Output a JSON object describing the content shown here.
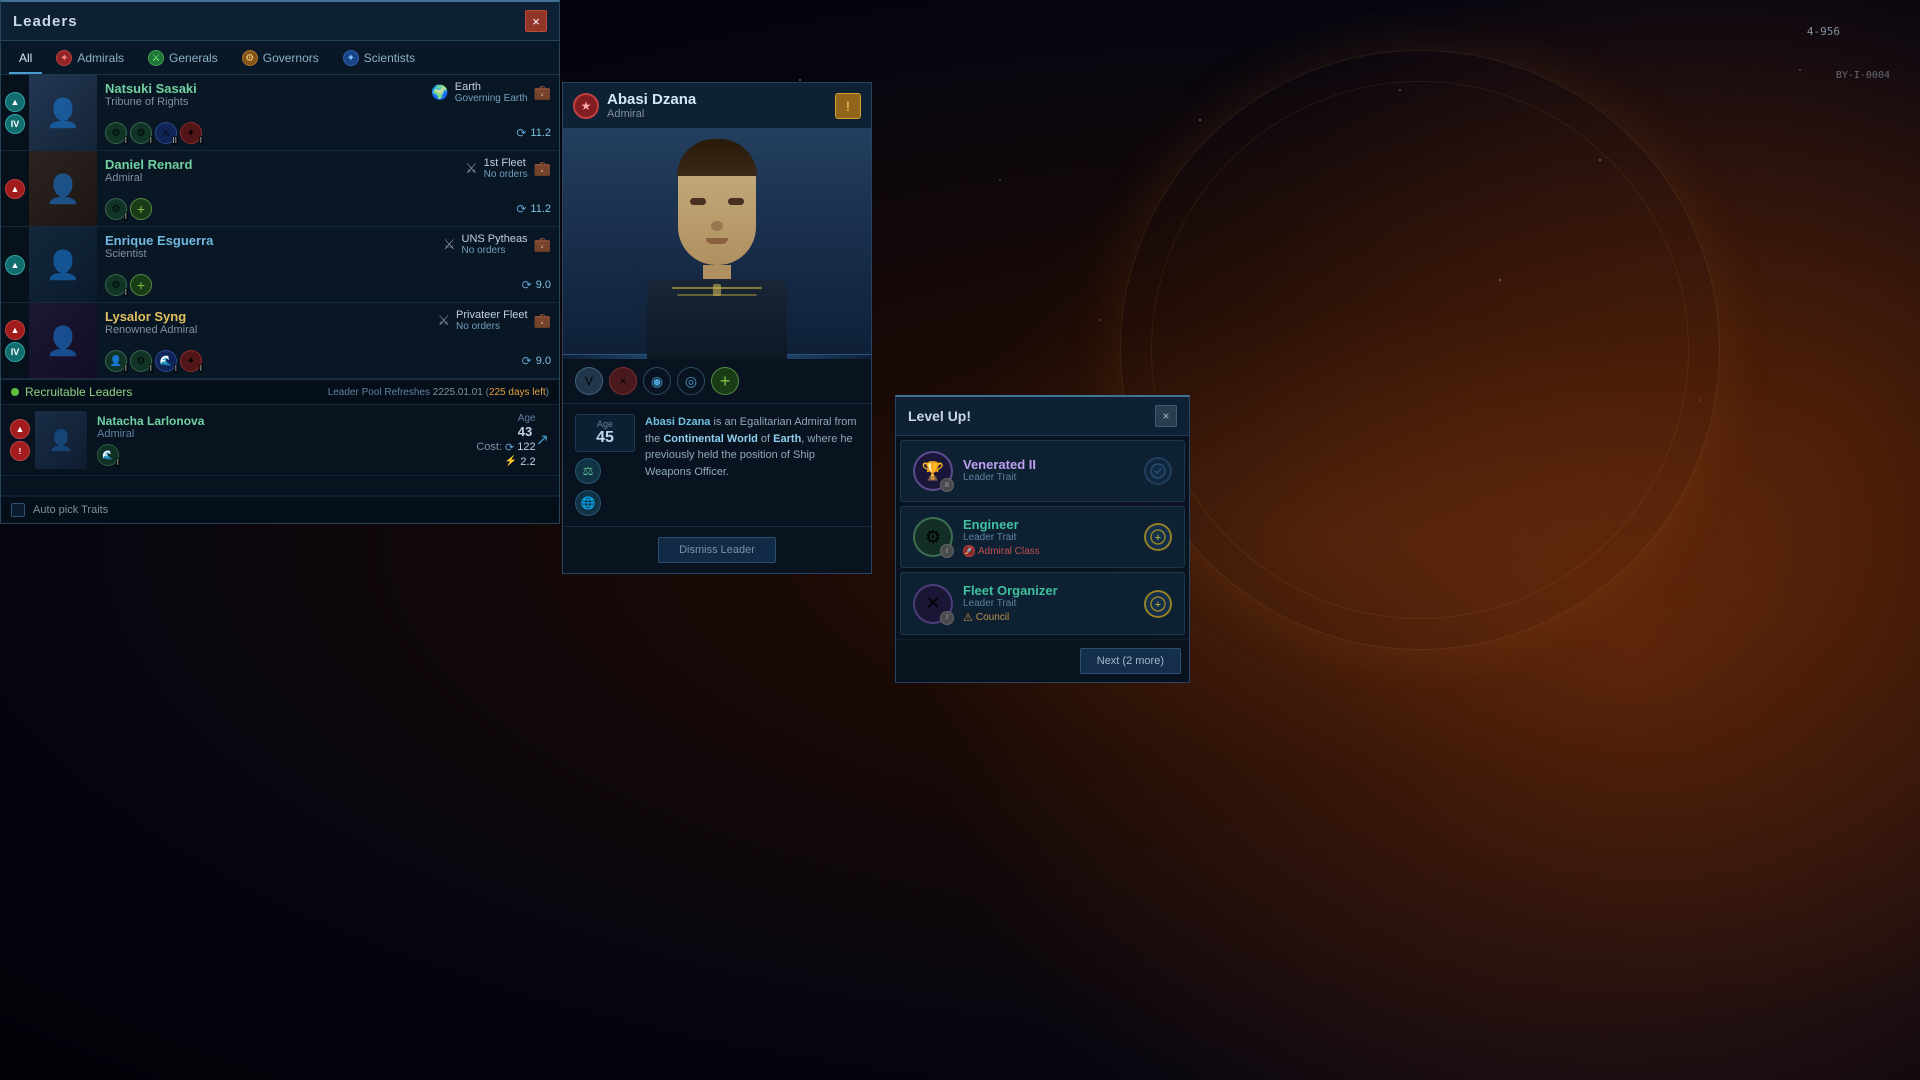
{
  "app": {
    "title": "Leaders",
    "close_label": "×"
  },
  "hud": {
    "coords": "4-956",
    "sector": "BY-I-0004"
  },
  "tabs": [
    {
      "id": "all",
      "label": "All",
      "icon": "◈",
      "icon_type": "default",
      "active": true
    },
    {
      "id": "admirals",
      "label": "Admirals",
      "icon": "✦",
      "icon_type": "red"
    },
    {
      "id": "generals",
      "label": "Generals",
      "icon": "⚔",
      "icon_type": "green"
    },
    {
      "id": "governors",
      "label": "Governors",
      "icon": "⚙",
      "icon_type": "orange"
    },
    {
      "id": "scientists",
      "label": "Scientists",
      "icon": "✦",
      "icon_type": "blue"
    }
  ],
  "leaders": [
    {
      "name": "Natsuki Sasaki",
      "role": "Tribune of Rights",
      "assignment": "Earth",
      "assignment_sub": "Governing Earth",
      "assignment_icon": "🌍",
      "level_badges": [
        "▲",
        "IV"
      ],
      "level_types": [
        "teal",
        "teal"
      ],
      "xp": "11.2",
      "has_storage": true,
      "traits": [
        "⚙",
        "⚙",
        "⚔",
        "✦"
      ],
      "trait_levels": [
        "I",
        "I",
        "II",
        "I"
      ]
    },
    {
      "name": "Daniel Renard",
      "role": "Admiral",
      "assignment": "1st Fleet",
      "assignment_sub": "No orders",
      "assignment_icon": "⚔",
      "level_badges": [
        "▲"
      ],
      "level_types": [
        "red"
      ],
      "xp": "11.2",
      "has_storage": true,
      "traits": [
        "⚙",
        "+"
      ],
      "trait_levels": [
        "I",
        ""
      ]
    },
    {
      "name": "Enrique Esguerra",
      "role": "Scientist",
      "assignment": "UNS Pytheas",
      "assignment_sub": "No orders",
      "assignment_icon": "⚔",
      "level_badges": [
        "▲"
      ],
      "level_types": [
        "teal"
      ],
      "xp": "9.0",
      "has_storage": true,
      "traits": [
        "⚙",
        "+"
      ],
      "trait_levels": [
        "I",
        ""
      ]
    },
    {
      "name": "Lysalor Syng",
      "role": "Renowned Admiral",
      "assignment": "Privateer Fleet",
      "assignment_sub": "No orders",
      "assignment_icon": "⚔",
      "level_badges": [
        "▲",
        "IV"
      ],
      "level_types": [
        "red",
        "teal"
      ],
      "xp": "9.0",
      "has_storage": true,
      "traits": [
        "👤",
        "⚙",
        "🌊",
        "✦"
      ],
      "trait_levels": [
        "I",
        "I",
        "I",
        "I"
      ]
    }
  ],
  "recruitable": {
    "section_label": "Recruitable Leaders",
    "refresh_label": "Leader Pool Refreshes",
    "refresh_date": "2225.01.01",
    "refresh_days": "225 days left",
    "leaders": [
      {
        "name": "Natacha Larlonova",
        "role": "Admiral",
        "age": 43,
        "age_label": "Age",
        "cost_label": "Cost:",
        "cost_energy": "122",
        "cost_influence": "2.2",
        "level_badge": "▲",
        "level_type": "red",
        "trait": "🌊",
        "hire_icon": "↗"
      }
    ]
  },
  "auto_pick": {
    "label": "Auto pick Traits"
  },
  "detail": {
    "name": "Abasi Dzana",
    "role": "Admiral",
    "faction_icon": "★",
    "warning_icon": "!",
    "age_label": "Age",
    "age": "45",
    "bio": "Abasi Dzana is an Egalitarian Admiral from the Continental World of Earth, where he previously held the position of Ship Weapons Officer.",
    "bio_name": "Abasi Dzana",
    "bio_world_type": "Continental World",
    "bio_world": "Earth",
    "bio_position": "Ship Weapons Officer",
    "dismiss_label": "Dismiss Leader",
    "traits": [
      "V",
      "×",
      "◉",
      "◎",
      "⊕"
    ],
    "trait_types": [
      "badge",
      "red",
      "blue",
      "blue",
      "add"
    ]
  },
  "levelup": {
    "title": "Level Up!",
    "close_icon": "×",
    "options": [
      {
        "id": "venerated2",
        "name": "Venerated II",
        "type": "Leader Trait",
        "icon": "🏆",
        "icon_badge": "II",
        "prereq": null,
        "council": null,
        "selectable": false
      },
      {
        "id": "engineer",
        "name": "Engineer",
        "type": "Leader Trait",
        "icon": "⚙",
        "icon_badge": "I",
        "prereq": "Admiral Class",
        "prereq_icon": "🚀",
        "council": null,
        "selectable": true
      },
      {
        "id": "fleet_organizer",
        "name": "Fleet Organizer",
        "type": "Leader Trait",
        "icon": "✕",
        "icon_badge": "I",
        "prereq": null,
        "council": "Council",
        "council_icon": "⚠",
        "selectable": true
      }
    ],
    "next_label": "Next (2 more)"
  }
}
